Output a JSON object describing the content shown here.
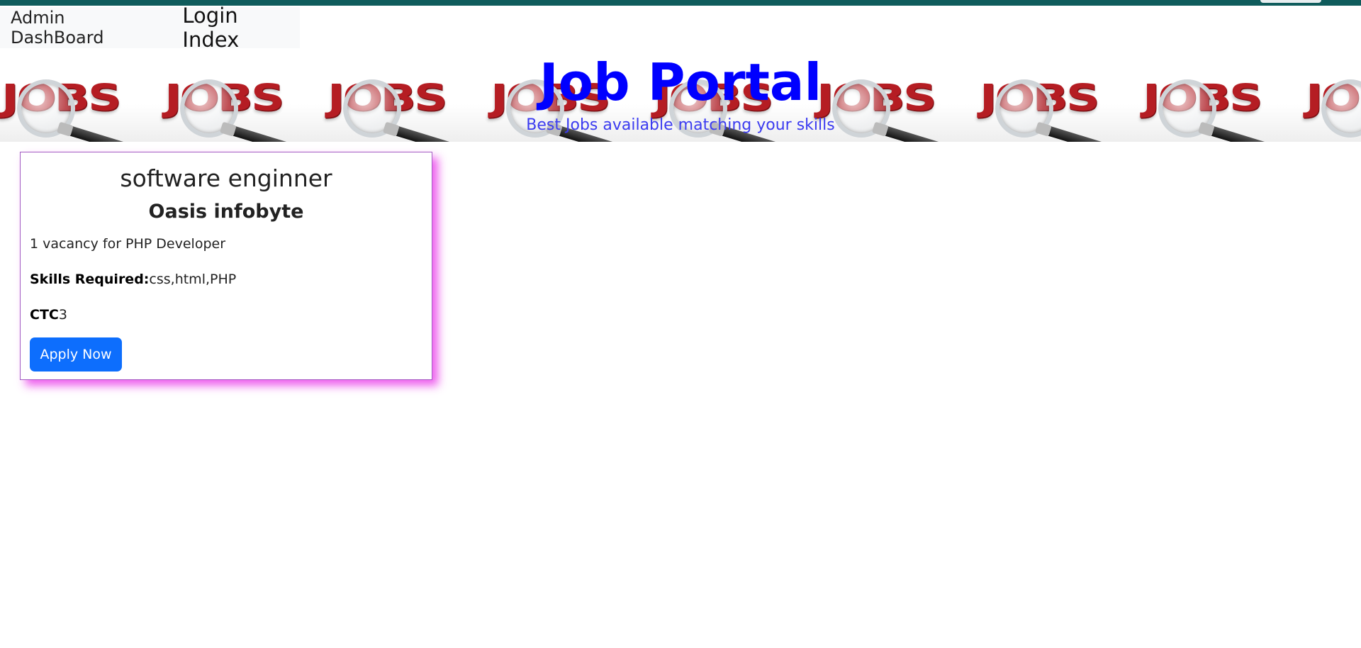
{
  "colors": {
    "top_strip": "#0f5c5c",
    "title": "#0000ff",
    "subtitle": "#3b3bf0",
    "card_shadow": "#eb44eb",
    "apply_button": "#0d6efd",
    "banner_word": "#b51d23"
  },
  "nav": {
    "admin_link": "Admin DashBoard",
    "login_link": "Login Index"
  },
  "hero": {
    "title": "Job Portal",
    "subtitle": "Best Jobs available matching your skills"
  },
  "banner": {
    "tile_text": "JOBS",
    "tile_icon": "magnifying-glass-icon"
  },
  "job": {
    "title": "software enginner",
    "company": "Oasis infobyte",
    "description": "1 vacancy for PHP Developer",
    "skills_label": "Skills Required:",
    "skills_value": "css,html,PHP",
    "ctc_label": "CTC",
    "ctc_value": "3",
    "apply_label": "Apply Now"
  }
}
